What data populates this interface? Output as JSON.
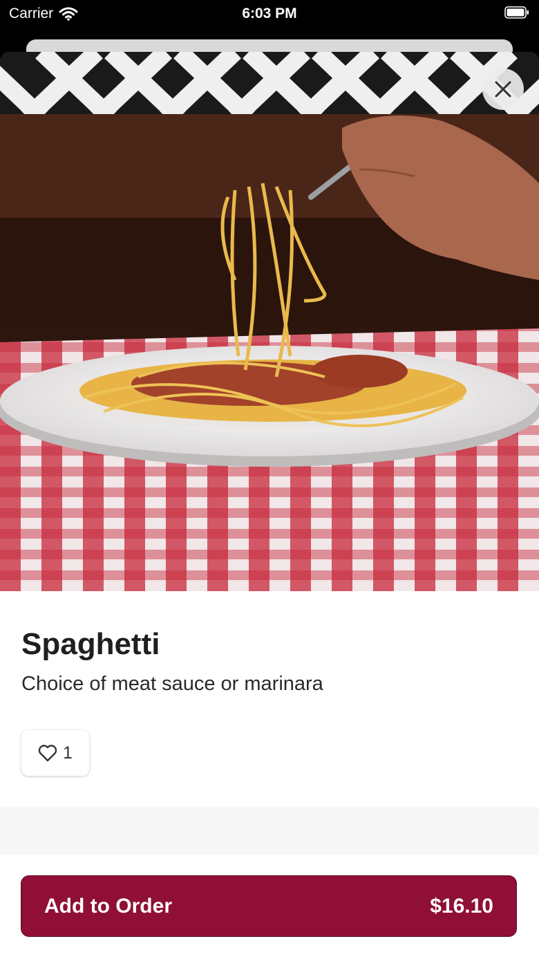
{
  "status_bar": {
    "carrier": "Carrier",
    "time": "6:03 PM"
  },
  "item": {
    "name": "Spaghetti",
    "description": "Choice of meat sauce or marinara",
    "likes": "1",
    "image": "spaghetti-photo"
  },
  "actions": {
    "add_to_order_label": "Add to Order",
    "price": "$16.10"
  },
  "colors": {
    "accent": "#8f0f36",
    "tablecloth_red": "#c8283a"
  },
  "icons": [
    "wifi-icon",
    "battery-icon",
    "close-icon",
    "heart-icon"
  ]
}
